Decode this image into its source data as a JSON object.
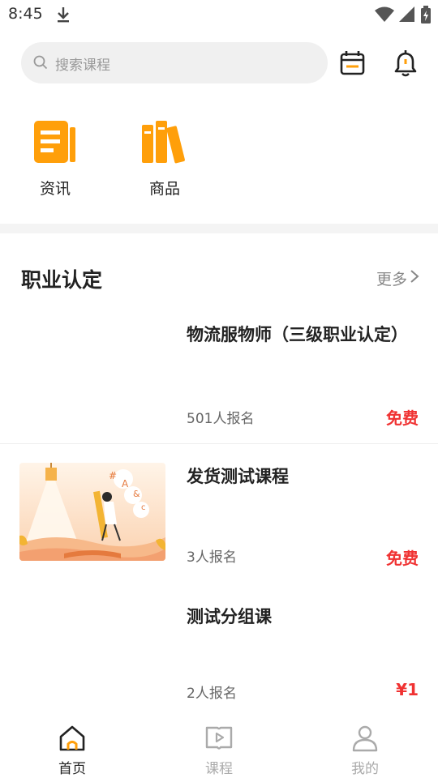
{
  "status": {
    "time": "8:45"
  },
  "search": {
    "placeholder": "搜索课程"
  },
  "quick_links": [
    {
      "label": "资讯",
      "icon": "document-icon"
    },
    {
      "label": "商品",
      "icon": "books-icon"
    }
  ],
  "section": {
    "title": "职业认定",
    "more": "更多"
  },
  "courses": [
    {
      "title": "物流服物师（三级职业认定）",
      "count": "501人报名",
      "price": "免费"
    },
    {
      "title": "发货测试课程",
      "count": "3人报名",
      "price": "免费"
    },
    {
      "title": "测试分组课",
      "count": "2人报名",
      "price": "¥1"
    }
  ],
  "tabs": [
    {
      "label": "首页",
      "active": true
    },
    {
      "label": "课程",
      "active": false
    },
    {
      "label": "我的",
      "active": false
    }
  ],
  "colors": {
    "accent": "#ff9f0a",
    "price": "#f03232",
    "active_tab": "#222222",
    "inactive_tab": "#aaaaaa"
  }
}
